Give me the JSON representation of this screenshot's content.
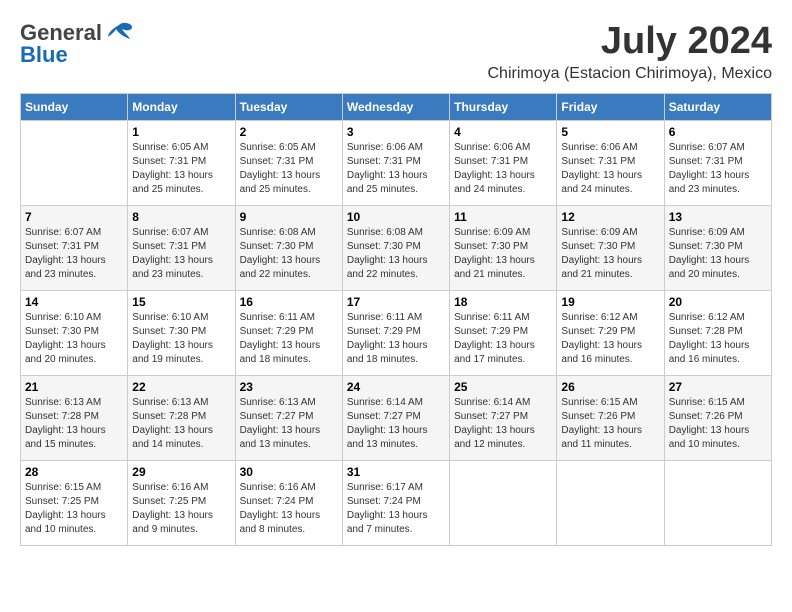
{
  "header": {
    "logo_general": "General",
    "logo_blue": "Blue",
    "month_year": "July 2024",
    "location": "Chirimoya (Estacion Chirimoya), Mexico"
  },
  "days_of_week": [
    "Sunday",
    "Monday",
    "Tuesday",
    "Wednesday",
    "Thursday",
    "Friday",
    "Saturday"
  ],
  "weeks": [
    [
      {
        "day": "",
        "info": ""
      },
      {
        "day": "1",
        "info": "Sunrise: 6:05 AM\nSunset: 7:31 PM\nDaylight: 13 hours\nand 25 minutes."
      },
      {
        "day": "2",
        "info": "Sunrise: 6:05 AM\nSunset: 7:31 PM\nDaylight: 13 hours\nand 25 minutes."
      },
      {
        "day": "3",
        "info": "Sunrise: 6:06 AM\nSunset: 7:31 PM\nDaylight: 13 hours\nand 25 minutes."
      },
      {
        "day": "4",
        "info": "Sunrise: 6:06 AM\nSunset: 7:31 PM\nDaylight: 13 hours\nand 24 minutes."
      },
      {
        "day": "5",
        "info": "Sunrise: 6:06 AM\nSunset: 7:31 PM\nDaylight: 13 hours\nand 24 minutes."
      },
      {
        "day": "6",
        "info": "Sunrise: 6:07 AM\nSunset: 7:31 PM\nDaylight: 13 hours\nand 23 minutes."
      }
    ],
    [
      {
        "day": "7",
        "info": "Sunrise: 6:07 AM\nSunset: 7:31 PM\nDaylight: 13 hours\nand 23 minutes."
      },
      {
        "day": "8",
        "info": "Sunrise: 6:07 AM\nSunset: 7:31 PM\nDaylight: 13 hours\nand 23 minutes."
      },
      {
        "day": "9",
        "info": "Sunrise: 6:08 AM\nSunset: 7:30 PM\nDaylight: 13 hours\nand 22 minutes."
      },
      {
        "day": "10",
        "info": "Sunrise: 6:08 AM\nSunset: 7:30 PM\nDaylight: 13 hours\nand 22 minutes."
      },
      {
        "day": "11",
        "info": "Sunrise: 6:09 AM\nSunset: 7:30 PM\nDaylight: 13 hours\nand 21 minutes."
      },
      {
        "day": "12",
        "info": "Sunrise: 6:09 AM\nSunset: 7:30 PM\nDaylight: 13 hours\nand 21 minutes."
      },
      {
        "day": "13",
        "info": "Sunrise: 6:09 AM\nSunset: 7:30 PM\nDaylight: 13 hours\nand 20 minutes."
      }
    ],
    [
      {
        "day": "14",
        "info": "Sunrise: 6:10 AM\nSunset: 7:30 PM\nDaylight: 13 hours\nand 20 minutes."
      },
      {
        "day": "15",
        "info": "Sunrise: 6:10 AM\nSunset: 7:30 PM\nDaylight: 13 hours\nand 19 minutes."
      },
      {
        "day": "16",
        "info": "Sunrise: 6:11 AM\nSunset: 7:29 PM\nDaylight: 13 hours\nand 18 minutes."
      },
      {
        "day": "17",
        "info": "Sunrise: 6:11 AM\nSunset: 7:29 PM\nDaylight: 13 hours\nand 18 minutes."
      },
      {
        "day": "18",
        "info": "Sunrise: 6:11 AM\nSunset: 7:29 PM\nDaylight: 13 hours\nand 17 minutes."
      },
      {
        "day": "19",
        "info": "Sunrise: 6:12 AM\nSunset: 7:29 PM\nDaylight: 13 hours\nand 16 minutes."
      },
      {
        "day": "20",
        "info": "Sunrise: 6:12 AM\nSunset: 7:28 PM\nDaylight: 13 hours\nand 16 minutes."
      }
    ],
    [
      {
        "day": "21",
        "info": "Sunrise: 6:13 AM\nSunset: 7:28 PM\nDaylight: 13 hours\nand 15 minutes."
      },
      {
        "day": "22",
        "info": "Sunrise: 6:13 AM\nSunset: 7:28 PM\nDaylight: 13 hours\nand 14 minutes."
      },
      {
        "day": "23",
        "info": "Sunrise: 6:13 AM\nSunset: 7:27 PM\nDaylight: 13 hours\nand 13 minutes."
      },
      {
        "day": "24",
        "info": "Sunrise: 6:14 AM\nSunset: 7:27 PM\nDaylight: 13 hours\nand 13 minutes."
      },
      {
        "day": "25",
        "info": "Sunrise: 6:14 AM\nSunset: 7:27 PM\nDaylight: 13 hours\nand 12 minutes."
      },
      {
        "day": "26",
        "info": "Sunrise: 6:15 AM\nSunset: 7:26 PM\nDaylight: 13 hours\nand 11 minutes."
      },
      {
        "day": "27",
        "info": "Sunrise: 6:15 AM\nSunset: 7:26 PM\nDaylight: 13 hours\nand 10 minutes."
      }
    ],
    [
      {
        "day": "28",
        "info": "Sunrise: 6:15 AM\nSunset: 7:25 PM\nDaylight: 13 hours\nand 10 minutes."
      },
      {
        "day": "29",
        "info": "Sunrise: 6:16 AM\nSunset: 7:25 PM\nDaylight: 13 hours\nand 9 minutes."
      },
      {
        "day": "30",
        "info": "Sunrise: 6:16 AM\nSunset: 7:24 PM\nDaylight: 13 hours\nand 8 minutes."
      },
      {
        "day": "31",
        "info": "Sunrise: 6:17 AM\nSunset: 7:24 PM\nDaylight: 13 hours\nand 7 minutes."
      },
      {
        "day": "",
        "info": ""
      },
      {
        "day": "",
        "info": ""
      },
      {
        "day": "",
        "info": ""
      }
    ]
  ]
}
